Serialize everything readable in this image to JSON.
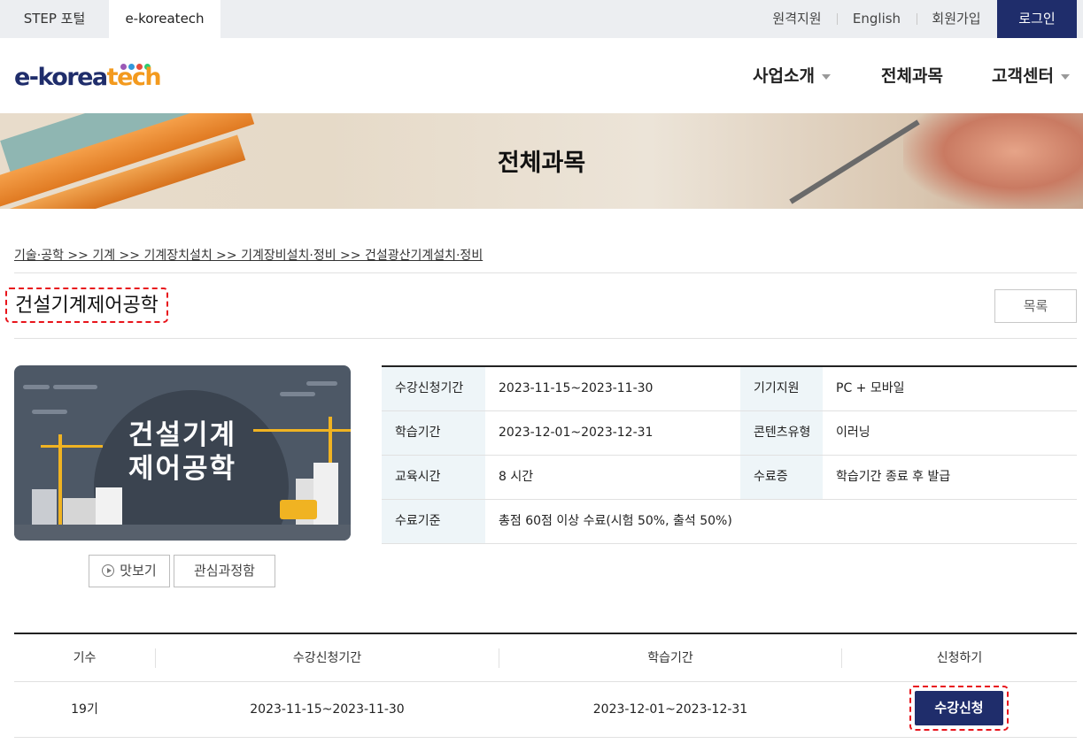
{
  "topbar": {
    "tabs": [
      "STEP 포털",
      "e-koreatech"
    ],
    "links": [
      "원격지원",
      "English",
      "회원가입"
    ],
    "login_label": "로그인"
  },
  "header": {
    "logo_text_main": "e-korea",
    "logo_text_accent": "tech",
    "logo_dot_colors": [
      "#9b59b6",
      "#3498db",
      "#e74c3c",
      "#2ecc71"
    ],
    "nav": [
      "사업소개",
      "전체과목",
      "고객센터"
    ]
  },
  "banner": {
    "title": "전체과목"
  },
  "breadcrumb": "기술·공학 >> 기계 >> 기계장치설치 >> 기계장비설치·정비 >> 건설광산기계설치·정비",
  "course": {
    "title": "건설기계제어공학",
    "list_button": "목록",
    "thumbnail_text": [
      "건설기계",
      "제어공학"
    ],
    "preview_button": "맛보기",
    "wishlist_button": "관심과정함"
  },
  "info": {
    "rows": [
      {
        "label1": "수강신청기간",
        "value1": "2023-11-15~2023-11-30",
        "label2": "기기지원",
        "value2": "PC + 모바일"
      },
      {
        "label1": "학습기간",
        "value1": "2023-12-01~2023-12-31",
        "label2": "콘텐츠유형",
        "value2": "이러닝"
      },
      {
        "label1": "교육시간",
        "value1": "8 시간",
        "label2": "수료증",
        "value2": "학습기간 종료 후 발급"
      },
      {
        "label1": "수료기준",
        "value1": "총점 60점 이상 수료(시험 50%, 출석 50%)"
      }
    ]
  },
  "schedule": {
    "headers": [
      "기수",
      "수강신청기간",
      "학습기간",
      "신청하기"
    ],
    "rows": [
      {
        "term": "19기",
        "apply_period": "2023-11-15~2023-11-30",
        "study_period": "2023-12-01~2023-12-31",
        "button": "수강신청"
      }
    ]
  },
  "colors": {
    "brand_navy": "#1f2d6b",
    "accent_orange": "#f39a1e",
    "highlight_red": "#e8141b",
    "info_label_bg": "#eef5f8"
  }
}
